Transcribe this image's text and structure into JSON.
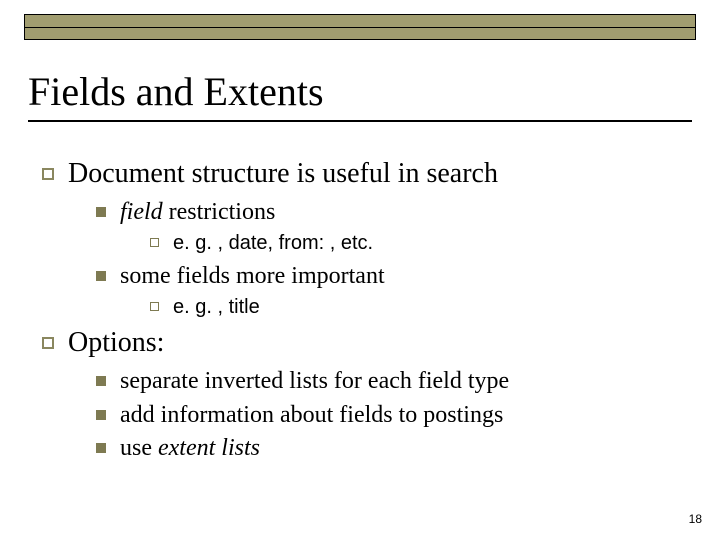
{
  "title": "Fields and Extents",
  "page_number": "18",
  "bullets": {
    "a": {
      "text": "Document structure is useful in search",
      "sub": {
        "a1": {
          "prefix_italic": "field",
          "rest": " restrictions",
          "sub": {
            "a1x": "e. g. , date, from: , etc."
          }
        },
        "a2": {
          "text": "some fields more important",
          "sub": {
            "a2x": "e. g. , title"
          }
        }
      }
    },
    "b": {
      "text": "Options:",
      "sub": {
        "b1": "separate inverted lists for each field type",
        "b2": "add information about fields to postings",
        "b3_prefix": "use ",
        "b3_italic": "extent lists"
      }
    }
  }
}
